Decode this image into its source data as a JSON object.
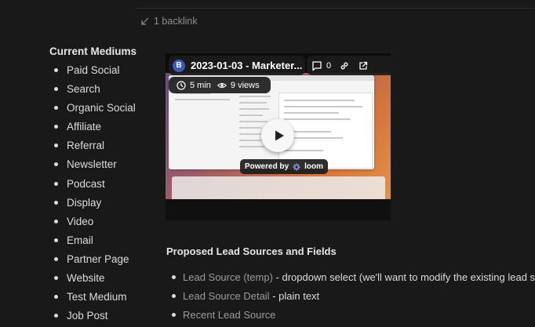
{
  "backlinks": {
    "label": "1 backlink"
  },
  "mediums": {
    "title": "Current Mediums",
    "items": [
      "Paid Social",
      "Search",
      "Organic Social",
      "Affiliate",
      "Referral",
      "Newsletter",
      "Podcast",
      "Display",
      "Video",
      "Email",
      "Partner Page",
      "Website",
      "Test Medium",
      "Job Post"
    ]
  },
  "video": {
    "avatar_initial": "B",
    "title": "2023-01-03 - Marketer...",
    "comments": "0",
    "duration": "5 min",
    "views": "9 views",
    "powered_by": "Powered by",
    "brand": "loom",
    "icons": [
      "clock-icon",
      "eye-icon",
      "comment-icon",
      "link-icon",
      "external-link-icon",
      "play-icon"
    ]
  },
  "lead_sources": {
    "title": "Proposed Lead Sources and Fields",
    "items": [
      {
        "link": "Lead Source (temp)",
        "text": " - dropdown select (we'll want to modify the existing lead source"
      },
      {
        "link": "Lead Source Detail",
        "text": " - plain text"
      },
      {
        "link": "Recent Lead Source",
        "text": ""
      }
    ]
  },
  "colors": {
    "background": "#191919",
    "text": "#dcdcdc",
    "muted_link": "#9b9b9b",
    "avatar": "#3b5bb7"
  }
}
